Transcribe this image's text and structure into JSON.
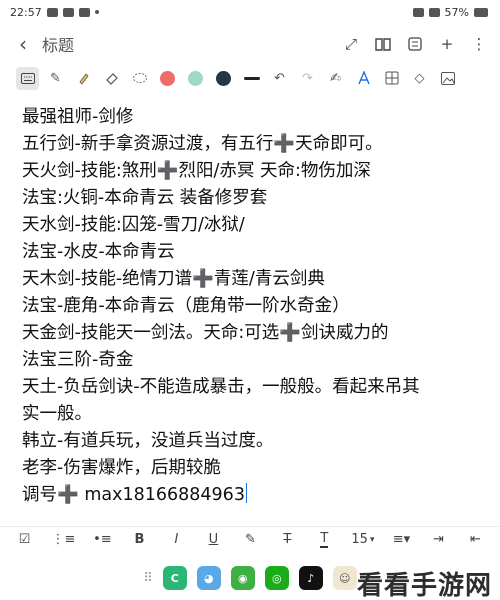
{
  "status": {
    "time": "22:57",
    "battery": "57%"
  },
  "header": {
    "title": "标题"
  },
  "toolbar": {
    "colors": [
      "#f26b6b",
      "#9fd9c4",
      "#1f3a40"
    ]
  },
  "note": {
    "lines": [
      "最强祖师-剑修",
      "五行剑-新手拿资源过渡，有五行➕天命即可。",
      "天火剑-技能:煞刑➕烈阳/赤冥 天命:物伤加深",
      "法宝:火铜-本命青云 装备修罗套",
      "天水剑-技能:囚笼-雪刀/冰狱/",
      "法宝-水皮-本命青云",
      "天木剑-技能-绝情刀谱➕青莲/青云剑典",
      "法宝-鹿角-本命青云（鹿角带一阶水奇金）",
      "天金剑-技能天一剑法。天命:可选➕剑诀威力的",
      "法宝三阶-奇金",
      "天土-负岳剑诀-不能造成暴击，一般般。看起来吊其",
      "实一般。",
      "韩立-有道兵玩，没道兵当过度。",
      "老李-伤害爆炸，后期较脆",
      "调号➕  max18166884963"
    ]
  },
  "format": {
    "font_size": "15"
  },
  "watermark": "看看手游网"
}
